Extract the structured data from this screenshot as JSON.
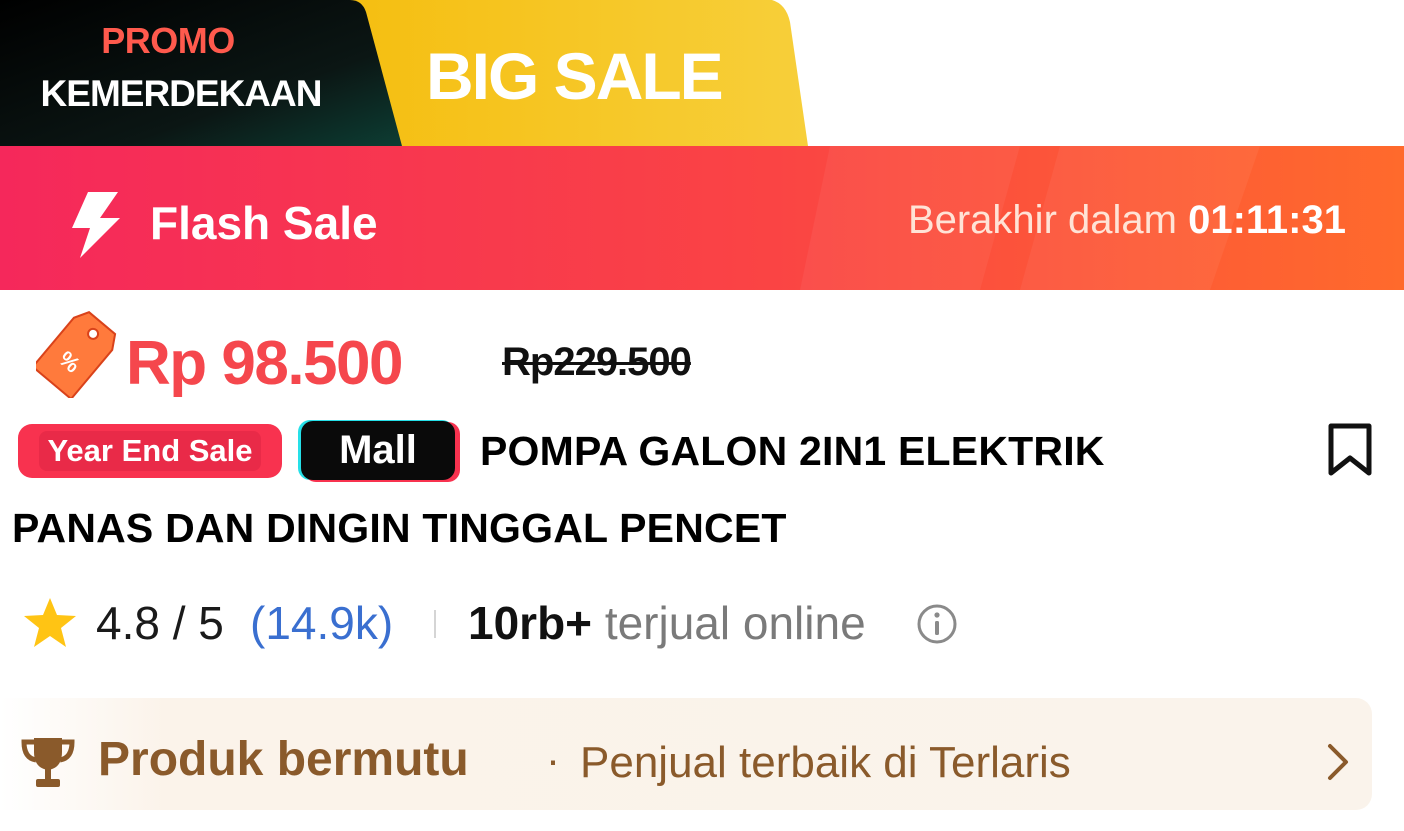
{
  "promo": {
    "line1": "PROMO",
    "line2": "KEMERDEKAAN",
    "big_sale": "BIG SALE"
  },
  "flash_sale": {
    "title": "Flash Sale",
    "ends_label": "Berakhir dalam",
    "countdown": "01:11:31"
  },
  "price": {
    "current": "Rp 98.500",
    "original": "Rp229.500"
  },
  "badges": {
    "year_end": "Year End Sale",
    "mall": "Mall"
  },
  "product": {
    "title_line1": "POMPA GALON 2IN1 ELEKTRIK",
    "title_line2": "PANAS DAN DINGIN TINGGAL PENCET"
  },
  "rating": {
    "score": "4.8 / 5",
    "count": "(14.9k)",
    "sold_number": "10rb+",
    "sold_label": "terjual online"
  },
  "quality": {
    "title": "Produk bermutu",
    "separator": "·",
    "subtitle": "Penjual terbaik di Terlaris"
  },
  "colors": {
    "price_red": "#f5474d",
    "flash_gradient_start": "#f5285b",
    "flash_gradient_end": "#ff6a2c",
    "promo_yellow": "#f6c61c",
    "rating_link_blue": "#3a6fd0",
    "quality_brown": "#8a5a2b"
  },
  "icons": {
    "flash": "lightning-bolt-icon",
    "price_tag": "discount-tag-icon",
    "bookmark": "bookmark-icon",
    "star": "star-icon",
    "info": "info-icon",
    "trophy": "trophy-icon",
    "chevron": "chevron-right-icon"
  }
}
